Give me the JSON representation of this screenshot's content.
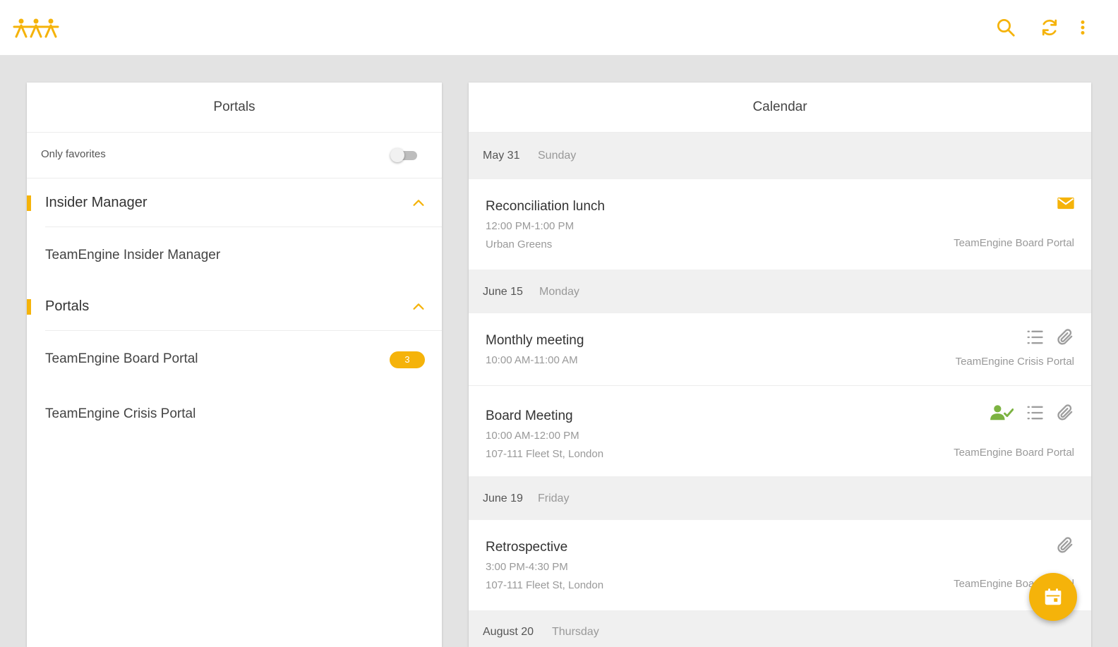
{
  "colors": {
    "accent": "#f5b30a",
    "green": "#7cb342",
    "grey_icon": "#9e9e9e",
    "background": "#e3e3e3"
  },
  "toolbar": {
    "logo_icon": "teamengine-logo-icon",
    "search_icon": "search-icon",
    "refresh_icon": "refresh-icon",
    "menu_icon": "more-vert-icon"
  },
  "left_panel": {
    "title": "Portals",
    "only_favorites_label": "Only favorites",
    "only_favorites_on": false,
    "sections": [
      {
        "title": "Insider Manager",
        "expanded": true,
        "items": [
          {
            "label": "TeamEngine Insider Manager"
          }
        ]
      },
      {
        "title": "Portals",
        "expanded": true,
        "items": [
          {
            "label": "TeamEngine Board Portal",
            "badge": "3"
          },
          {
            "label": "TeamEngine Crisis Portal"
          }
        ]
      }
    ]
  },
  "calendar": {
    "title": "Calendar",
    "groups": [
      {
        "date": "May 31",
        "weekday": "Sunday",
        "events": [
          {
            "title": "Reconciliation lunch",
            "time": "12:00 PM-1:00 PM",
            "location": "Urban Greens",
            "portal": "TeamEngine Board Portal",
            "icons": [
              "mail-icon"
            ]
          }
        ]
      },
      {
        "date": "June 15",
        "weekday": "Monday",
        "events": [
          {
            "title": "Monthly meeting",
            "time": "10:00 AM-11:00 AM",
            "portal": "TeamEngine Crisis Portal",
            "icons": [
              "agenda-list-icon",
              "attachment-icon"
            ]
          },
          {
            "title": "Board Meeting",
            "time": "10:00 AM-12:00 PM",
            "location": "107-111 Fleet St, London",
            "portal": "TeamEngine Board Portal",
            "icons": [
              "user-check-icon",
              "agenda-list-icon",
              "attachment-icon"
            ]
          }
        ]
      },
      {
        "date": "June 19",
        "weekday": "Friday",
        "events": [
          {
            "title": "Retrospective",
            "time": "3:00 PM-4:30 PM",
            "location": "107-111 Fleet St, London",
            "portal": "TeamEngine Board Portal",
            "icons": [
              "attachment-icon"
            ]
          }
        ]
      },
      {
        "date": "August 20",
        "weekday": "Thursday",
        "events": []
      }
    ]
  },
  "fab": {
    "icon": "calendar-add-icon"
  }
}
